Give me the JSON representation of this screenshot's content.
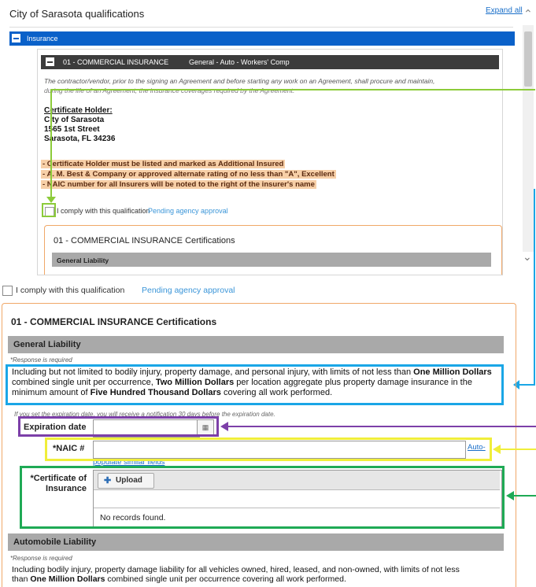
{
  "top": {
    "title": "City of Sarasota qualifications",
    "expand_all": "Expand all",
    "insurance_label": "Insurance",
    "commercial_bar": {
      "name": "01 - COMMERCIAL INSURANCE",
      "coverages": "General - Auto - Workers' Comp"
    },
    "intro_line_1": "The contractor/vendor, prior to the signing an Agreement and before starting any work on an Agreement, shall procure and maintain,",
    "intro_line_2": "during the life of an Agreement, the insurance coverages required by the Agreement.",
    "certificate_holder": {
      "heading": "Certificate Holder:",
      "line1": "City of Sarasota",
      "line2": "1565 1st Street",
      "line3": "Sarasota, FL 34236"
    },
    "highlights": [
      "- Certificate Holder must be listed and marked as Additional Insured",
      "- A. M. Best & Company or approved alternate rating of no less than \"A\", Excellent",
      "- NAIC number for all Insurers will be noted to the right of the insurer's name"
    ],
    "comply_label": "I comply with this qualification",
    "pending": "Pending agency approval",
    "cert_title": "01 - COMMERCIAL INSURANCE Certifications",
    "general_liability": "General Liability"
  },
  "bottom": {
    "comply_label": "I comply with this qualification",
    "pending": "Pending agency approval",
    "cert_title": "01 - COMMERCIAL INSURANCE Certifications",
    "general_liability": {
      "title": "General Liability",
      "required": "*Response is required",
      "desc_1": "Including but not limited to bodily injury, property damage, and personal injury, with limits of not less than ",
      "desc_bold_1": "One Million Dollars",
      "desc_2": " combined single unit per occurrence, ",
      "desc_bold_2": "Two Million Dollars",
      "desc_3": " per location aggregate plus property damage insurance in the minimum amount of ",
      "desc_bold_3": "Five Hundred Thousand Dollars",
      "desc_4": " covering all work performed."
    },
    "expiration_note": "If you set the expiration date, you will receive a notification 30 days before the expiration date.",
    "expiration_label": "Expiration date",
    "expiration_value": "",
    "naic_label": "*NAIC #",
    "naic_value": "",
    "auto_link_1": "Auto-",
    "auto_link_2": "populate similar fields",
    "coi_label": "*Certificate of Insurance",
    "upload_label": "Upload",
    "no_records": "No records found.",
    "automobile_liability": {
      "title": "Automobile Liability",
      "required": "*Response is required",
      "desc_1": "Including bodily injury, property damage liability for all vehicles owned, hired, leased, and non-owned, with limits of not less",
      "desc_2": "than ",
      "desc_bold_1": "One Million Dollars",
      "desc_3": " combined single unit per occurrence covering all work performed."
    }
  },
  "annotation_colors": {
    "green_light": "#8ccb3a",
    "blue": "#1aa6e6",
    "purple": "#7c3fa8",
    "yellow": "#f0ee3a",
    "green": "#1faa55"
  }
}
